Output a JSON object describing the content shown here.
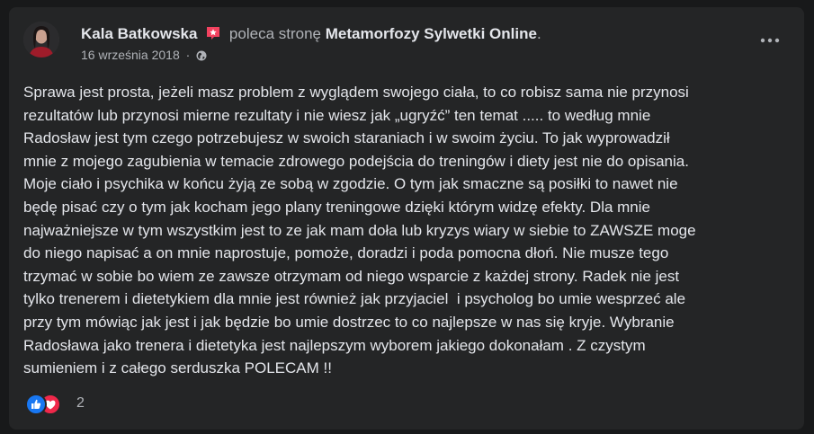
{
  "post": {
    "author": "Kala Batkowska",
    "action": "poleca stronę",
    "page": "Metamorfozy Sylwetki Online",
    "period": ".",
    "date": "16 września 2018",
    "separator": "·",
    "privacy_icon": "globe-icon",
    "more_icon": "more-options-icon",
    "text": "Sprawa jest prosta, jeżeli masz problem z wyglądem swojego ciała, to co robisz sama nie przynosi\nrezultatów lub przynosi mierne rezultaty i nie wiesz jak „ugryźć” ten temat ..... to według mnie\nRadosław jest tym czego potrzebujesz w swoich staraniach i w swoim życiu. To jak wyprowadził\nmnie z mojego zagubienia w temacie zdrowego podejścia do treningów i diety jest nie do opisania.\nMoje ciało i psychika w końcu żyją ze sobą w zgodzie. O tym jak smaczne są posiłki to nawet nie\nbędę pisać czy o tym jak kocham jego plany treningowe dzięki którym widzę efekty. Dla mnie\nnajważniejsze w tym wszystkim jest to ze jak mam doła lub kryzys wiary w siebie to ZAWSZE moge\ndo niego napisać a on mnie naprostuje, pomoże, doradzi i poda pomocna dłoń. Nie musze tego\ntrzymać w sobie bo wiem ze zawsze otrzymam od niego wsparcie z każdej strony. Radek nie jest\ntylko trenerem i dietetykiem dla mnie jest również jak przyjaciel  i psycholog bo umie wesprzeć ale\nprzy tym mówiąc jak jest i jak będzie bo umie dostrzec to co najlepsze w nas się kryje. Wybranie\nRadosława jako trenera i dietetyka jest najlepszym wyborem jakiego dokonałam . Z czystym\nsumieniem i z całego serduszka POLECAM !!",
    "reactions": {
      "count": "2",
      "icons": [
        "like-icon",
        "love-icon"
      ]
    }
  },
  "colors": {
    "background": "#18191a",
    "card": "#242526",
    "text_primary": "#e4e6eb",
    "text_secondary": "#b0b3b8",
    "like": "#1877f2",
    "love": "#f0284a",
    "recommend_badge": "#f3425f"
  }
}
